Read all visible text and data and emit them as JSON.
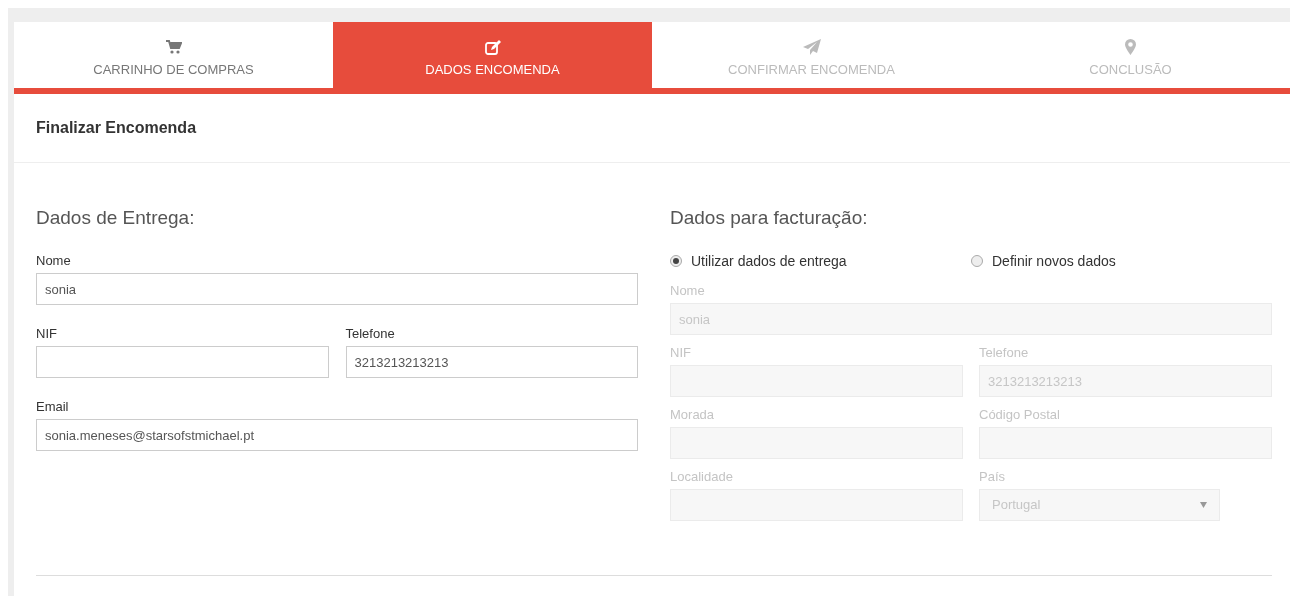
{
  "steps": [
    {
      "label": "CARRINHO DE COMPRAS",
      "selected": false,
      "completed": true
    },
    {
      "label": "DADOS ENCOMENDA",
      "selected": true,
      "completed": false
    },
    {
      "label": "CONFIRMAR ENCOMENDA",
      "selected": false,
      "completed": false
    },
    {
      "label": "CONCLUSÃO",
      "selected": false,
      "completed": false
    }
  ],
  "panel_title": "Finalizar Encomenda",
  "delivery": {
    "heading": "Dados de Entrega:",
    "rows": [
      [
        {
          "label": "Nome",
          "value": "sonia",
          "kind": "text",
          "disabled": false
        }
      ],
      [
        {
          "label": "NIF",
          "kind": "text",
          "disabled": false
        },
        {
          "label": "Telefone",
          "value": "3213213213213",
          "kind": "text",
          "disabled": false
        }
      ],
      [
        {
          "label": "Email",
          "value": "sonia.meneses@starsofstmichael.pt",
          "kind": "text",
          "disabled": false
        }
      ]
    ]
  },
  "billing": {
    "heading": "Dados para facturação:",
    "options": [
      {
        "label": "Utilizar dados de entrega",
        "selected": true
      },
      {
        "label": "Definir novos dados",
        "selected": false
      }
    ],
    "rows": [
      [
        {
          "label": "Nome",
          "value": "sonia",
          "kind": "text",
          "disabled": true
        }
      ],
      [
        {
          "label": "NIF",
          "kind": "text",
          "disabled": true
        },
        {
          "label": "Telefone",
          "value": "3213213213213",
          "kind": "text",
          "disabled": true
        }
      ],
      [
        {
          "label": "Morada",
          "kind": "text",
          "disabled": true
        },
        {
          "label": "Código Postal",
          "kind": "text",
          "disabled": true
        }
      ],
      [
        {
          "label": "Localidade",
          "kind": "text",
          "disabled": true
        },
        {
          "label": "País",
          "value": "Portugal",
          "kind": "select",
          "disabled": true
        }
      ]
    ]
  }
}
